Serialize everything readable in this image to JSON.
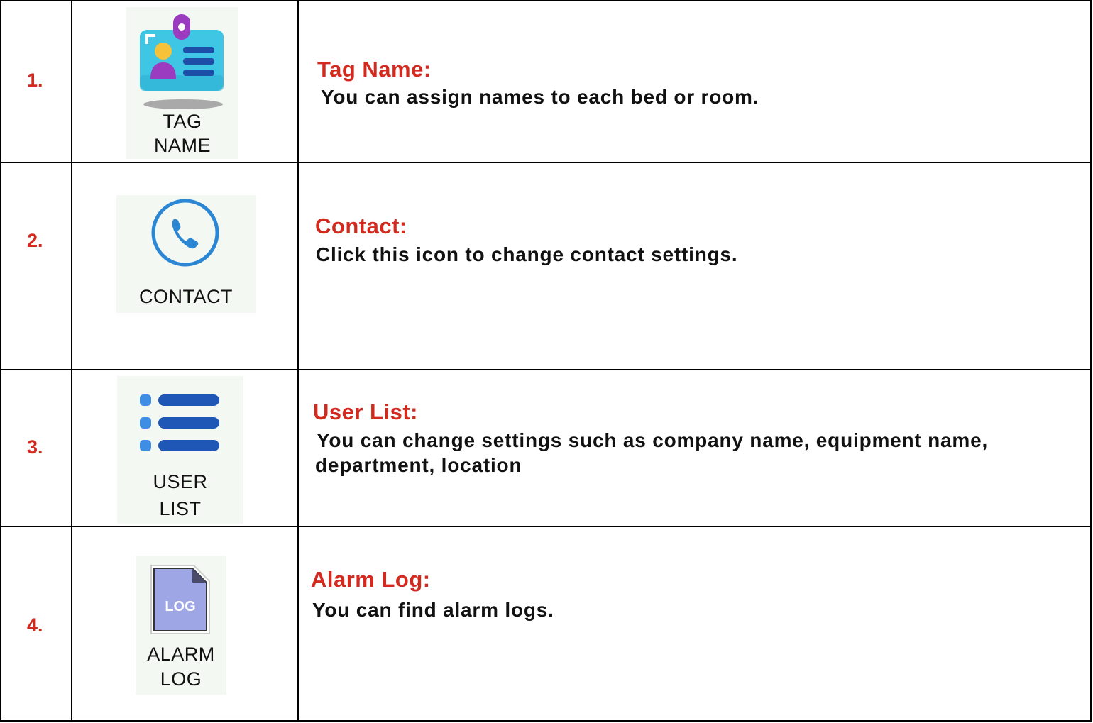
{
  "colors": {
    "accent_red": "#d32a1f",
    "phone_blue": "#2b86d4",
    "list_blue": "#1f57b7",
    "list_dot": "#3e8ee6",
    "log_page": "#9fa6e6"
  },
  "rows": [
    {
      "number": "1.",
      "icon": "id-badge-icon",
      "icon_label_line1": "TAG",
      "icon_label_line2": "NAME",
      "title": "Tag Name:",
      "description": "You can assign names to each bed or room."
    },
    {
      "number": "2.",
      "icon": "phone-icon",
      "icon_label_line1": "CONTACT",
      "title": "Contact:",
      "description": "Click this icon to change contact settings."
    },
    {
      "number": "3.",
      "icon": "list-icon",
      "icon_label_line1": "USER",
      "icon_label_line2": "LIST",
      "title": "User List:",
      "description_line1": "You can change settings such as company name, equipment name,",
      "description_line2": "department, location"
    },
    {
      "number": "4.",
      "icon": "log-file-icon",
      "icon_text": "LOG",
      "icon_label_line1": "ALARM",
      "icon_label_line2": "LOG",
      "title": "Alarm Log:",
      "description": "You can find alarm logs."
    }
  ]
}
